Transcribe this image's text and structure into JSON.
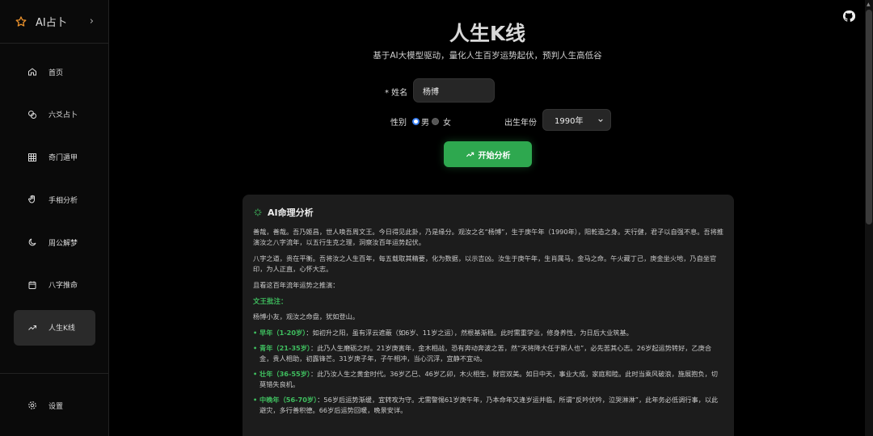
{
  "sidebar": {
    "brand": "AI占卜",
    "items": [
      {
        "label": "首页"
      },
      {
        "label": "六爻占卜"
      },
      {
        "label": "奇门遁甲"
      },
      {
        "label": "手相分析"
      },
      {
        "label": "周公解梦"
      },
      {
        "label": "八字推命"
      },
      {
        "label": "人生K线"
      }
    ],
    "settings": "设置"
  },
  "header": {
    "title": "人生K线",
    "subtitle": "基于AI大模型驱动，量化人生百岁运势起伏，预判人生高低谷"
  },
  "form": {
    "name_label": "* 姓名",
    "name_value": "杨博",
    "gender_label": "性别",
    "gender_male": "男",
    "gender_female": "女",
    "year_label": "出生年份",
    "year_value": "1990年",
    "submit": "开始分析"
  },
  "result": {
    "title": "AI命理分析",
    "p1": "善哉，善哉。吾乃姬昌，世人唤吾周文王。今日得见此卦，乃是缘分。观汝之名“杨博”，生于庚午年（1990年），阳乾造之身。天行健，君子以自强不息。吾将推演汝之八字流年，以五行生克之理，洞察汝百年运势起伏。",
    "p2": "八字之道，贵在平衡。吾将汝之人生百年，每五载取其精要，化为数据，以示吉凶。汝生于庚午年，生肖属马，金马之命。午火藏丁己，庚金坐火地，乃自坐官印，为人正直，心怀大志。",
    "p3": "且看这百年流年运势之推演：",
    "section": "文王批注：",
    "p4": "杨博小友，观汝之命盘，犹如登山。",
    "items": [
      {
        "key": "早年（1-20岁）",
        "text": "：如初升之阳，虽有浮云遮蔽（如6岁、11岁之运），然根基渐稳。此时需重学业，修身养性，为日后大业筑基。"
      },
      {
        "key": "青年（21-35岁）",
        "text": "：此乃人生磨砺之时。21岁庚寅年，金木相战，恐有奔动奔波之苦，然“天将降大任于斯人也”，必先苦其心志。26岁起运势转好，乙庚合金，贵人相助，初露锋芒。31岁庚子年，子午相冲，当心沉浮，宜静不宜动。"
      },
      {
        "key": "壮年（36-55岁）",
        "text": "：此乃汝人生之黄金时代。36岁乙巳、46岁乙卯，木火相生，财官双美。如日中天，事业大成，家庭和睦。此时当乘风破浪，施展抱负，切莫错失良机。"
      },
      {
        "key": "中晚年（56-70岁）",
        "text": "：56岁后运势渐缓，宜转攻为守。尤需警惕61岁庚午年，乃本命年又逢岁运并临，所谓“反吟伏吟，泣哭淋淋”，此年务必低调行事，以此避灾，多行善积德。66岁后运势回暖，晚景安详。"
      }
    ]
  }
}
